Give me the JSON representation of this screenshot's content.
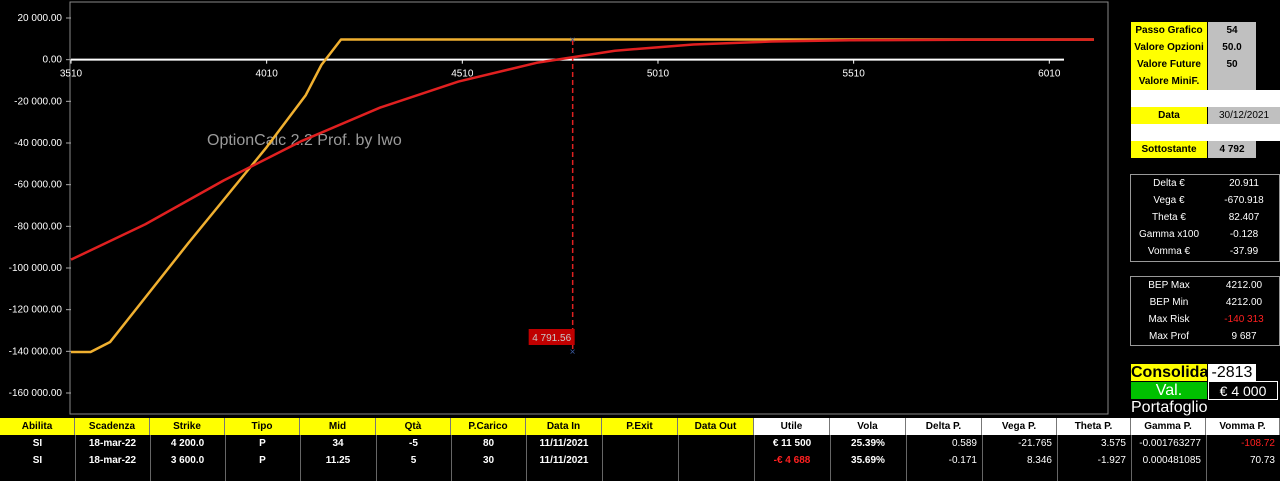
{
  "chart_data": {
    "type": "line",
    "title": "",
    "watermark": "OptionCalc 2.2 Prof. by Iwo",
    "xlim": [
      3510,
      6160
    ],
    "ylim": [
      -160000,
      20000
    ],
    "x_ticks": [
      3510,
      4010,
      4510,
      5010,
      5510,
      6010
    ],
    "x_tick_labels": [
      "3510",
      "4010",
      "4510",
      "5010",
      "5510",
      "6010"
    ],
    "y_ticks": [
      20000,
      0,
      -20000,
      -40000,
      -60000,
      -80000,
      -100000,
      -120000,
      -140000,
      -160000
    ],
    "y_tick_labels": [
      "20 000.00",
      "0.00",
      "-20 000.00",
      "-40 000.00",
      "-60 000.00",
      "-80 000.00",
      "-100 000.00",
      "-120 000.00",
      "-140 000.00",
      "-160 000.00"
    ],
    "series": [
      {
        "color": "#f0b030",
        "x": [
          3510,
          3560,
          3610,
          3810,
          4010,
          4110,
          4150,
          4200,
          4300,
          4600,
          5000,
          5500,
          6000,
          6160
        ],
        "values": [
          -140313,
          -140313,
          -135500,
          -88000,
          -42000,
          -17000,
          -2500,
          9687,
          9687,
          9687,
          9687,
          9687,
          9687,
          9687
        ]
      },
      {
        "color": "#e02020",
        "x": [
          3510,
          3700,
          3900,
          4100,
          4300,
          4500,
          4700,
          4900,
          5100,
          5300,
          5500,
          5800,
          6160
        ],
        "values": [
          -96000,
          -79000,
          -58000,
          -39000,
          -23000,
          -10500,
          -1500,
          4300,
          7300,
          8700,
          9300,
          9550,
          9650
        ]
      }
    ],
    "marker": {
      "x": 4792,
      "label": "4 791.56"
    },
    "zero_line_color": "#ffffff"
  },
  "params": {
    "passo_label": "Passo Grafico",
    "passo_value": "54",
    "opzioni_label": "Valore Opzioni",
    "opzioni_value": "50.0",
    "future_label": "Valore Future",
    "future_value": "50",
    "minif_label": "Valore MiniF.",
    "minif_value": "",
    "data_label": "Data",
    "data_value": "30/12/2021",
    "sott_label": "Sottostante",
    "sott_value": "4 792"
  },
  "greeks": [
    {
      "label": "Delta €",
      "value": "20.911"
    },
    {
      "label": "Vega €",
      "value": "-670.918"
    },
    {
      "label": "Theta €",
      "value": "82.407"
    },
    {
      "label": "Gamma x100",
      "value": "-0.128"
    },
    {
      "label": "Vomma €",
      "value": "-37.99"
    }
  ],
  "bep": [
    {
      "label": "BEP Max",
      "value": "4212.00"
    },
    {
      "label": "BEP Min",
      "value": "4212.00"
    },
    {
      "label": "Max Risk",
      "value": "-140 313"
    },
    {
      "label": "Max Prof",
      "value": "9 687"
    }
  ],
  "summary": {
    "consolidato_label": "Consolidato",
    "consolidato_value": "-2813",
    "portafoglio_label": "Val. Portafoglio",
    "portafoglio_value": "€ 4 000"
  },
  "table": {
    "headers": [
      "Abilita",
      "Scadenza",
      "Strike",
      "Tipo",
      "Mid",
      "Qtà",
      "P.Carico",
      "Data In",
      "P.Exit",
      "Data Out",
      "Utile",
      "Vola",
      "Delta P.",
      "Vega P.",
      "Theta P.",
      "Gamma P.",
      "Vomma P."
    ],
    "rows": [
      [
        "SI",
        "18-mar-22",
        "4 200.0",
        "P",
        "34",
        "-5",
        "80",
        "11/11/2021",
        "",
        "",
        "€ 11 500",
        "25.39%",
        "0.589",
        "-21.765",
        "3.575",
        "-0.001763277",
        "-108.72"
      ],
      [
        "SI",
        "18-mar-22",
        "3 600.0",
        "P",
        "11.25",
        "5",
        "30",
        "11/11/2021",
        "",
        "",
        "-€ 4 688",
        "35.69%",
        "-0.171",
        "8.346",
        "-1.927",
        "0.000481085",
        "70.73"
      ]
    ]
  }
}
